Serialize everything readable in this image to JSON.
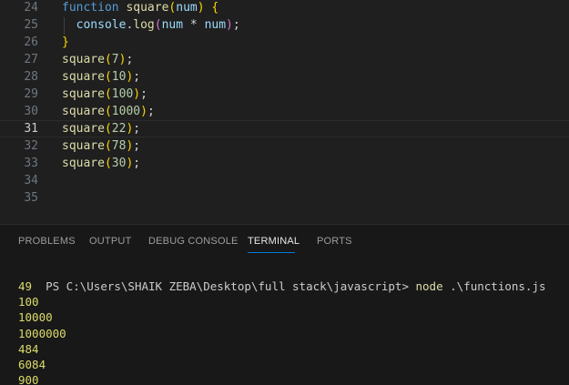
{
  "editor": {
    "lines": [
      {
        "n": "24",
        "tokens": [
          {
            "t": "function",
            "c": "kw"
          },
          {
            "t": " ",
            "c": "plain"
          },
          {
            "t": "square",
            "c": "fn"
          },
          {
            "t": "(",
            "c": "br1"
          },
          {
            "t": "num",
            "c": "prm"
          },
          {
            "t": ")",
            "c": "br1"
          },
          {
            "t": " ",
            "c": "plain"
          },
          {
            "t": "{",
            "c": "br1"
          }
        ]
      },
      {
        "n": "25",
        "tokens": [
          {
            "t": "  ",
            "c": "plain"
          },
          {
            "t": "console",
            "c": "prm"
          },
          {
            "t": ".",
            "c": "plain"
          },
          {
            "t": "log",
            "c": "fn"
          },
          {
            "t": "(",
            "c": "br2"
          },
          {
            "t": "num",
            "c": "prm"
          },
          {
            "t": " * ",
            "c": "plain"
          },
          {
            "t": "num",
            "c": "prm"
          },
          {
            "t": ")",
            "c": "br2"
          },
          {
            "t": ";",
            "c": "plain"
          }
        ]
      },
      {
        "n": "26",
        "tokens": [
          {
            "t": "}",
            "c": "br1"
          }
        ]
      },
      {
        "n": "27",
        "tokens": [
          {
            "t": "square",
            "c": "fn"
          },
          {
            "t": "(",
            "c": "br1"
          },
          {
            "t": "7",
            "c": "num"
          },
          {
            "t": ")",
            "c": "br1"
          },
          {
            "t": ";",
            "c": "plain"
          }
        ]
      },
      {
        "n": "28",
        "tokens": [
          {
            "t": "square",
            "c": "fn"
          },
          {
            "t": "(",
            "c": "br1"
          },
          {
            "t": "10",
            "c": "num"
          },
          {
            "t": ")",
            "c": "br1"
          },
          {
            "t": ";",
            "c": "plain"
          }
        ]
      },
      {
        "n": "29",
        "tokens": [
          {
            "t": "square",
            "c": "fn"
          },
          {
            "t": "(",
            "c": "br1"
          },
          {
            "t": "100",
            "c": "num"
          },
          {
            "t": ")",
            "c": "br1"
          },
          {
            "t": ";",
            "c": "plain"
          }
        ]
      },
      {
        "n": "30",
        "tokens": [
          {
            "t": "square",
            "c": "fn"
          },
          {
            "t": "(",
            "c": "br1"
          },
          {
            "t": "1000",
            "c": "num"
          },
          {
            "t": ")",
            "c": "br1"
          },
          {
            "t": ";",
            "c": "plain"
          }
        ]
      },
      {
        "n": "31",
        "tokens": [
          {
            "t": "square",
            "c": "fn"
          },
          {
            "t": "(",
            "c": "br1"
          },
          {
            "t": "22",
            "c": "num"
          },
          {
            "t": ")",
            "c": "br1"
          },
          {
            "t": ";",
            "c": "plain"
          }
        ],
        "current": true
      },
      {
        "n": "32",
        "tokens": [
          {
            "t": "square",
            "c": "fn"
          },
          {
            "t": "(",
            "c": "br1"
          },
          {
            "t": "78",
            "c": "num"
          },
          {
            "t": ")",
            "c": "br1"
          },
          {
            "t": ";",
            "c": "plain"
          }
        ]
      },
      {
        "n": "33",
        "tokens": [
          {
            "t": "square",
            "c": "fn"
          },
          {
            "t": "(",
            "c": "br1"
          },
          {
            "t": "30",
            "c": "num"
          },
          {
            "t": ")",
            "c": "br1"
          },
          {
            "t": ";",
            "c": "plain"
          }
        ]
      },
      {
        "n": "34",
        "tokens": []
      },
      {
        "n": "35",
        "tokens": []
      }
    ]
  },
  "panel": {
    "tabs": {
      "problems": "PROBLEMS",
      "output": "OUTPUT",
      "debug_console": "DEBUG CONSOLE",
      "terminal": "TERMINAL",
      "ports": "PORTS"
    },
    "active_tab": "terminal",
    "terminal": {
      "prompt": "PS C:\\Users\\SHAIK ZEBA\\Desktop\\full stack\\javascript> ",
      "command": "node",
      "argument": " .\\functions.js",
      "output": [
        "49",
        "100",
        "10000",
        "1000000",
        "484",
        "6084",
        "900"
      ]
    }
  },
  "colors": {
    "editor_bg": "#1f1f1f",
    "panel_bg": "#181818",
    "keyword": "#569cd6",
    "function": "#dcdcaa",
    "variable": "#9cdcfe",
    "number": "#b5cea8",
    "bracket_level1": "#ffd700",
    "bracket_level2": "#da70d6",
    "active_tab_underline": "#0078d4",
    "terminal_output": "#dcdc6a"
  }
}
